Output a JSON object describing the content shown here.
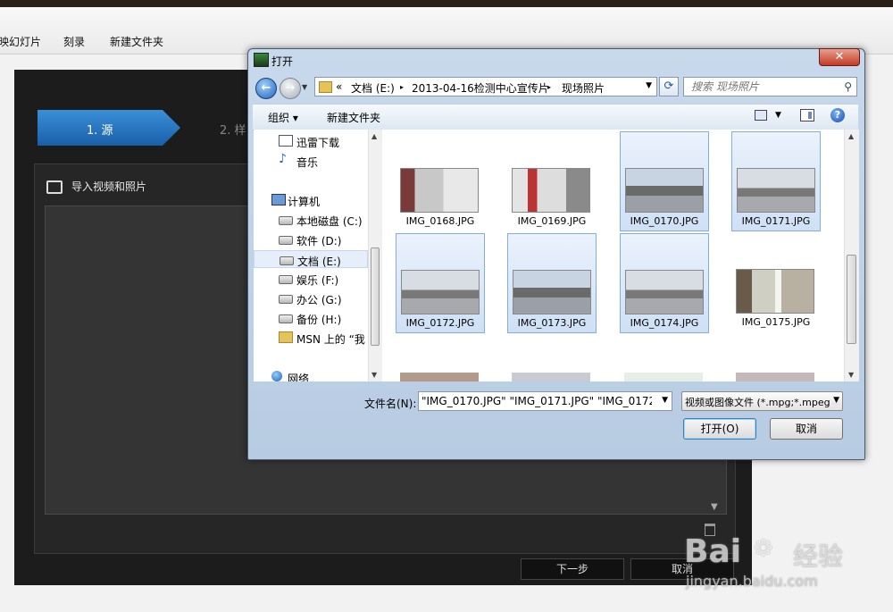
{
  "app": {
    "menu": [
      "映幻灯片",
      "刻录",
      "新建文件夹"
    ],
    "step1": "1. 源",
    "step2": "2. 样",
    "import_label": "导入视频和照片",
    "next_button": "下一步",
    "cancel_button": "取消"
  },
  "dialog": {
    "title": "打开",
    "close_glyph": "✕",
    "address": {
      "chevron": "«",
      "segments": [
        "文档 (E:)",
        "2013-04-16检测中心宣传片",
        "现场照片"
      ],
      "separator": "▸"
    },
    "search_placeholder": "搜索 现场照片",
    "toolbar": {
      "organize": "组织 ▾",
      "new_folder": "新建文件夹"
    },
    "nav": [
      {
        "label": "迅雷下载",
        "icon": "download-icon"
      },
      {
        "label": "音乐",
        "icon": "music-icon"
      },
      {
        "label": "计算机",
        "icon": "computer-icon"
      },
      {
        "label": "本地磁盘 (C:)",
        "icon": "drive-icon"
      },
      {
        "label": "软件 (D:)",
        "icon": "drive-icon"
      },
      {
        "label": "文档 (E:)",
        "icon": "drive-icon",
        "selected": true
      },
      {
        "label": "娱乐 (F:)",
        "icon": "drive-icon"
      },
      {
        "label": "办公 (G:)",
        "icon": "drive-icon"
      },
      {
        "label": "备份 (H:)",
        "icon": "drive-icon"
      },
      {
        "label": "MSN 上的 “我",
        "icon": "folder-icon"
      },
      {
        "label": "网络",
        "icon": "network-icon"
      }
    ],
    "files": [
      {
        "name": "IMG_0168.JPG",
        "selected": false
      },
      {
        "name": "IMG_0169.JPG",
        "selected": false
      },
      {
        "name": "IMG_0170.JPG",
        "selected": true
      },
      {
        "name": "IMG_0171.JPG",
        "selected": true
      },
      {
        "name": "IMG_0172.JPG",
        "selected": true
      },
      {
        "name": "IMG_0173.JPG",
        "selected": true
      },
      {
        "name": "IMG_0174.JPG",
        "selected": true
      },
      {
        "name": "IMG_0175.JPG",
        "selected": false
      }
    ],
    "filename_label": "文件名(N):",
    "filename_value": "\"IMG_0170.JPG\" \"IMG_0171.JPG\" \"IMG_0172.JP",
    "filetype_value": "视频或图像文件  (*.mpg;*.mpeg",
    "open_button": "打开(O)",
    "cancel_button": "取消"
  },
  "watermark": {
    "brand": "Bai",
    "brand2": "经验",
    "url": "jingyan.baidu.com"
  }
}
